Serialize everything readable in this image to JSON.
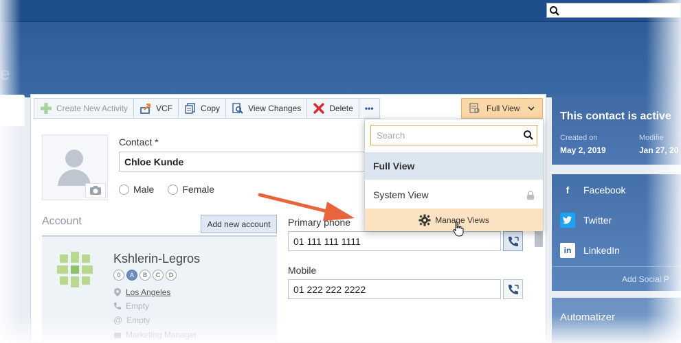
{
  "header": {
    "search_placeholder": "",
    "hero_title_fragment": "e"
  },
  "toolbar": {
    "create_activity": "Create New Activity",
    "vcf": "VCF",
    "copy": "Copy",
    "view_changes": "View Changes",
    "delete": "Delete",
    "more": "•••",
    "view_selector": "Full View"
  },
  "contact": {
    "label": "Contact *",
    "name": "Chloe Kunde",
    "gender_male": "Male",
    "gender_female": "Female"
  },
  "account": {
    "label": "Account",
    "add_button": "Add new account",
    "name": "Kshlerin-Legros",
    "ratings": [
      "0",
      "A",
      "B",
      "C",
      "D"
    ],
    "active_rating": "A",
    "city": "Los Angeles",
    "phone_empty": "Empty",
    "email_empty": "Empty",
    "role": "Marketing Manager"
  },
  "phones": {
    "primary_label": "Primary phone",
    "primary_value": "01 111 111 1111",
    "mobile_label": "Mobile",
    "mobile_value": "01 222 222 2222"
  },
  "views_dropdown": {
    "search_placeholder": "Search",
    "items": [
      "Full View",
      "System View"
    ],
    "manage": "Manage Views"
  },
  "status": {
    "title": "This contact is active",
    "created_label": "Created on",
    "created_value": "May 2, 2019",
    "modified_label": "Modifie",
    "modified_value": "Jan 27, 20"
  },
  "social": {
    "items": [
      "Facebook",
      "Twitter",
      "LinkedIn"
    ],
    "add": "Add Social P"
  },
  "automatizer": {
    "title": "Automatizer"
  },
  "colors": {
    "header_blue": "#1f4e8c",
    "view_button": "#fbd7a6",
    "manage_row": "#fbe3c2",
    "arrow": "#e8643c",
    "delete_red": "#d9272e"
  }
}
